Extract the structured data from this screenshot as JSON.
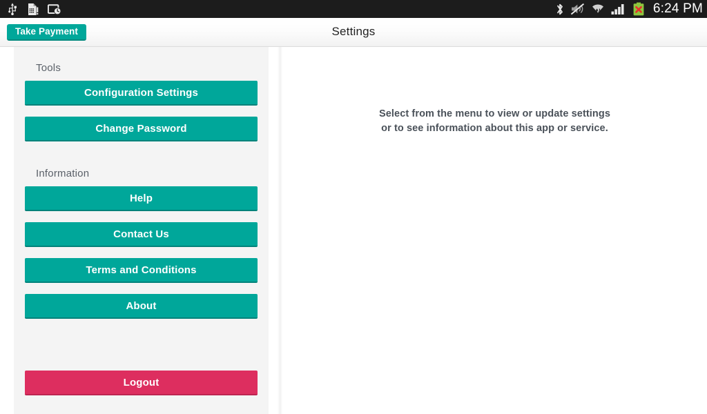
{
  "statusbar": {
    "background": "#1c1c1c",
    "time": "6:24 PM",
    "left_icons": [
      {
        "name": "usb-icon",
        "label": "USB connected"
      },
      {
        "name": "file-warning-icon",
        "label": "Storage warning"
      },
      {
        "name": "screenshot-clock-icon",
        "label": "Screenshot / recent"
      }
    ],
    "right_icons": [
      {
        "name": "bluetooth-icon",
        "label": "Bluetooth"
      },
      {
        "name": "mute-icon",
        "label": "Silent / vibrate off"
      },
      {
        "name": "wifi-icon",
        "label": "Wi-Fi connected"
      },
      {
        "name": "cellular-signal-icon",
        "label": "Cellular signal"
      },
      {
        "name": "battery-error-icon",
        "label": "Battery charging error"
      }
    ]
  },
  "actionbar": {
    "take_payment_label": "Take Payment",
    "title": "Settings",
    "accent_color": "#00a79a"
  },
  "sidebar": {
    "sections": [
      {
        "title": "Tools",
        "items": [
          {
            "label": "Configuration Settings",
            "name": "configuration-settings"
          },
          {
            "label": "Change Password",
            "name": "change-password"
          }
        ]
      },
      {
        "title": "Information",
        "items": [
          {
            "label": "Help",
            "name": "help"
          },
          {
            "label": "Contact Us",
            "name": "contact-us"
          },
          {
            "label": "Terms and Conditions",
            "name": "terms-and-conditions"
          },
          {
            "label": "About",
            "name": "about"
          }
        ]
      }
    ],
    "logout_label": "Logout",
    "button_color": "#00a79a",
    "logout_color": "#dd2e5f",
    "panel_color": "#f4f4f4"
  },
  "main": {
    "message_line1": "Select from the menu to view or update settings",
    "message_line2": "or to see information about this app or service."
  }
}
